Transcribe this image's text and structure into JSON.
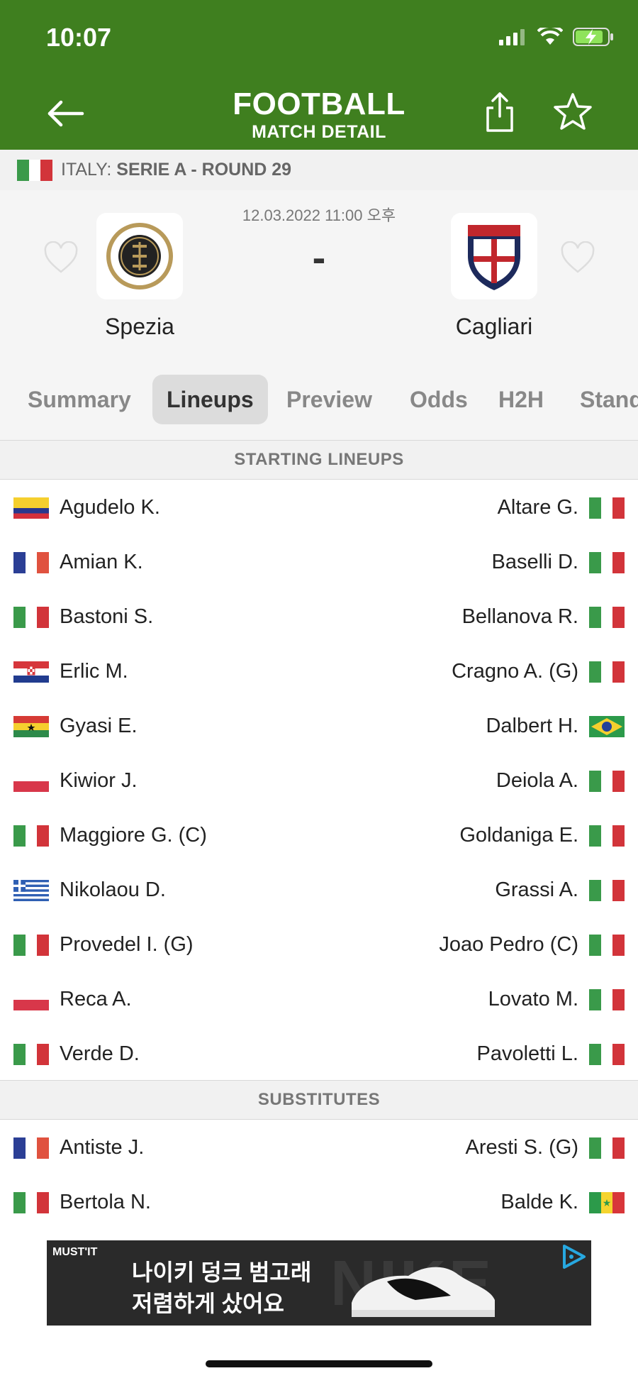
{
  "status_bar": {
    "time": "10:07"
  },
  "header": {
    "title": "FOOTBALL",
    "subtitle": "MATCH DETAIL"
  },
  "league": {
    "country": "ITALY:",
    "name": "SERIE A - ROUND 29"
  },
  "match": {
    "datetime": "12.03.2022 11:00 오후",
    "score": "-",
    "home": {
      "name": "Spezia"
    },
    "away": {
      "name": "Cagliari"
    }
  },
  "tabs": [
    {
      "label": "Summary"
    },
    {
      "label": "Lineups",
      "active": true
    },
    {
      "label": "Preview"
    },
    {
      "label": "Odds"
    },
    {
      "label": "H2H"
    },
    {
      "label": "Standings"
    }
  ],
  "lineups": {
    "starting_title": "STARTING LINEUPS",
    "starting": [
      {
        "home": "Agudelo K.",
        "home_flag": "colombia",
        "away": "Altare G.",
        "away_flag": "italy"
      },
      {
        "home": "Amian K.",
        "home_flag": "france",
        "away": "Baselli D.",
        "away_flag": "italy"
      },
      {
        "home": "Bastoni S.",
        "home_flag": "italy",
        "away": "Bellanova R.",
        "away_flag": "italy"
      },
      {
        "home": "Erlic M.",
        "home_flag": "croatia",
        "away": "Cragno A. (G)",
        "away_flag": "italy"
      },
      {
        "home": "Gyasi E.",
        "home_flag": "ghana",
        "away": "Dalbert H.",
        "away_flag": "brazil"
      },
      {
        "home": "Kiwior J.",
        "home_flag": "poland",
        "away": "Deiola A.",
        "away_flag": "italy"
      },
      {
        "home": "Maggiore G. (C)",
        "home_flag": "italy",
        "away": "Goldaniga E.",
        "away_flag": "italy"
      },
      {
        "home": "Nikolaou D.",
        "home_flag": "greece",
        "away": "Grassi A.",
        "away_flag": "italy"
      },
      {
        "home": "Provedel I. (G)",
        "home_flag": "italy",
        "away": "Joao Pedro (C)",
        "away_flag": "italy"
      },
      {
        "home": "Reca A.",
        "home_flag": "poland",
        "away": "Lovato M.",
        "away_flag": "italy"
      },
      {
        "home": "Verde D.",
        "home_flag": "italy",
        "away": "Pavoletti L.",
        "away_flag": "italy"
      }
    ],
    "subs_title": "SUBSTITUTES",
    "substitutes": [
      {
        "home": "Antiste J.",
        "home_flag": "france",
        "away": "Aresti S. (G)",
        "away_flag": "italy"
      },
      {
        "home": "Bertola N.",
        "home_flag": "italy",
        "away": "Balde K.",
        "away_flag": "senegal"
      }
    ]
  },
  "ad": {
    "brand": "MUST'IT",
    "line1": "나이키 덩크 범고래",
    "line2": "저렴하게 샀어요",
    "watermark": "NIKE"
  },
  "colors": {
    "brand_green": "#3f7f1f",
    "tab_active_bg": "#dcdcdc"
  }
}
